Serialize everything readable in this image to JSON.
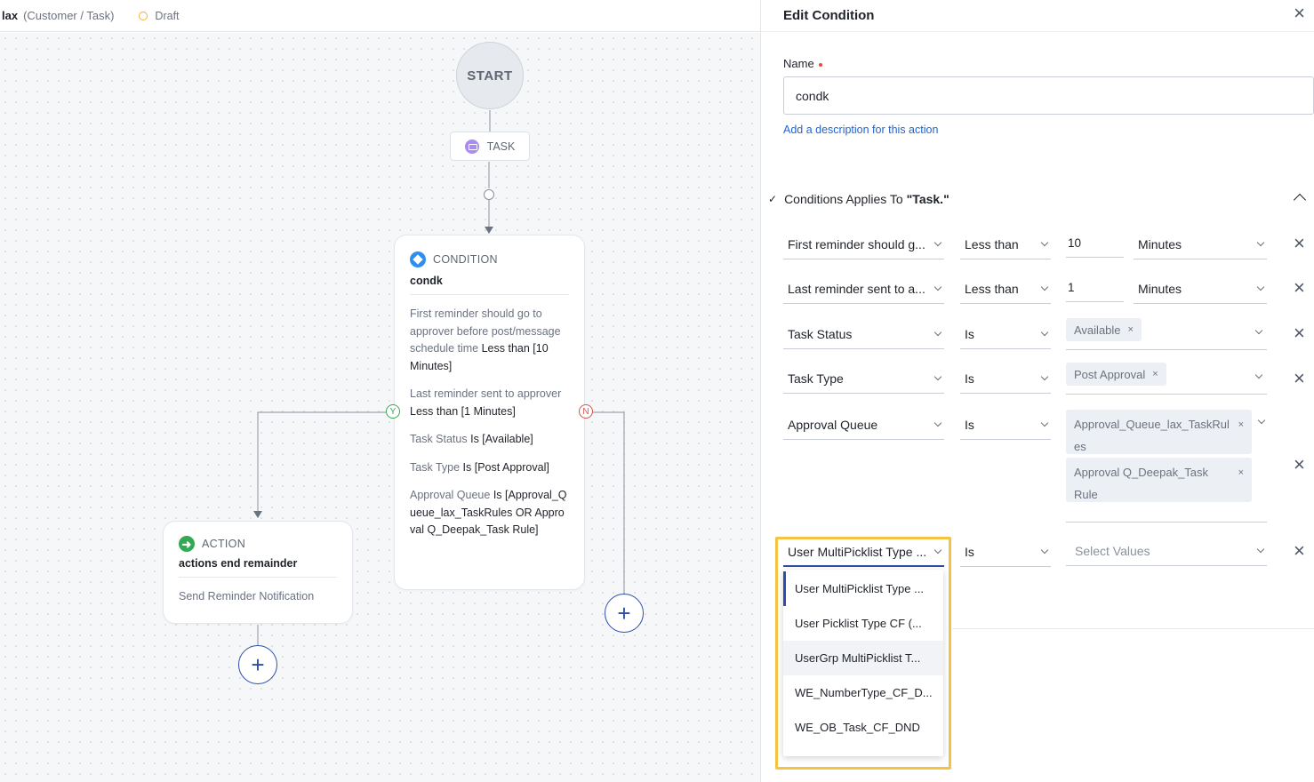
{
  "topbar": {
    "workflow_name": "lax",
    "context": "(Customer / Task)",
    "status": "Draft"
  },
  "canvas": {
    "start_label": "START",
    "task_label": "TASK",
    "branch_yes": "Y",
    "branch_no": "N",
    "condition_node": {
      "type_label": "CONDITION",
      "title": "condk",
      "conditions": [
        {
          "field": "First reminder should go to approver before post/message schedule time",
          "rule": "Less than [10 Minutes]"
        },
        {
          "field": "Last reminder sent to approver",
          "rule": "Less than [1 Minutes]"
        },
        {
          "field": "Task Status",
          "rule": "Is [Available]"
        },
        {
          "field": "Task Type",
          "rule": "Is [Post Approval]"
        },
        {
          "field": "Approval Queue",
          "rule": "Is [Approval_Queue_lax_TaskRules OR Approval Q_Deepak_Task Rule]"
        }
      ]
    },
    "action_node": {
      "type_label": "ACTION",
      "title": "actions end remainder",
      "subtitle": "Send Reminder Notification"
    },
    "add_symbol": "+"
  },
  "panel": {
    "title": "Edit Condition",
    "close_symbol": "×",
    "name_label": "Name",
    "name_value": "condk",
    "add_description": "Add a description for this action",
    "applies_check": "✓",
    "applies_text": "Conditions Applies To",
    "applies_entity": "\"Task.\"",
    "rows": [
      {
        "field": "First reminder should g...",
        "operator": "Less than",
        "value": "10",
        "unit": "Minutes"
      },
      {
        "field": "Last reminder sent to a...",
        "operator": "Less than",
        "value": "1",
        "unit": "Minutes"
      },
      {
        "field": "Task Status",
        "operator": "Is",
        "chips": [
          "Available"
        ]
      },
      {
        "field": "Task Type",
        "operator": "Is",
        "chips": [
          "Post Approval"
        ]
      },
      {
        "field": "Approval Queue",
        "operator": "Is",
        "chips": [
          "Approval_Queue_lax_TaskRul es",
          "Approval Q_Deepak_Task Rule"
        ]
      },
      {
        "field": "User MultiPicklist Type ...",
        "operator": "Is",
        "placeholder": "Select Values"
      }
    ],
    "chip_remove": "×",
    "dropdown_options": [
      "User MultiPicklist Type ...",
      "User Picklist Type CF (...",
      "UserGrp MultiPicklist T...",
      "WE_NumberType_CF_D...",
      "WE_OB_Task_CF_DND"
    ]
  },
  "colors": {
    "accent": "#2d4ea8",
    "highlight": "#f5c242",
    "condition_icon": "#2f8ff0",
    "action_icon": "#34a853",
    "task_icon": "#a98bf3",
    "no_branch": "#d9534f"
  }
}
